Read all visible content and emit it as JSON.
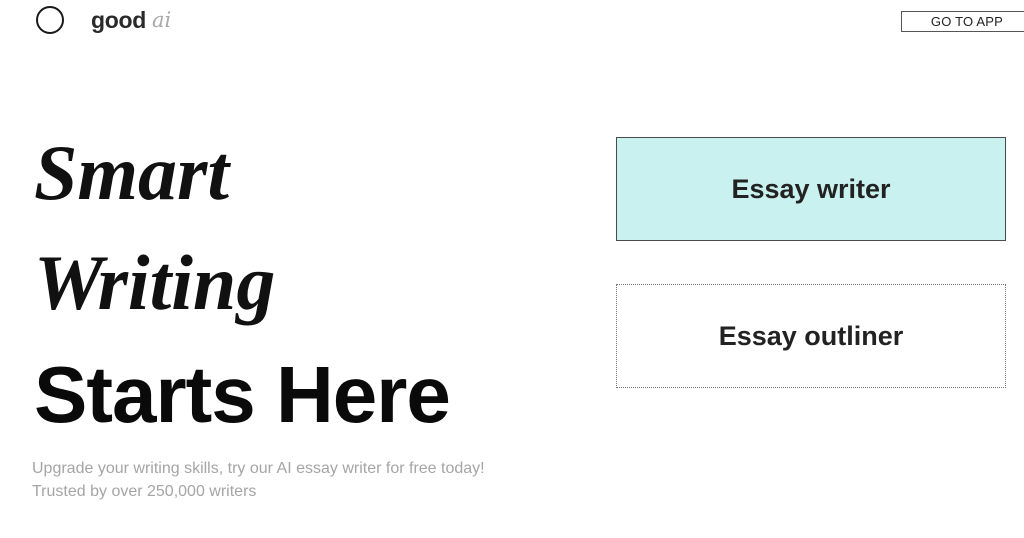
{
  "header": {
    "logo_text": "good",
    "logo_suffix": "ai",
    "cta_label": "GO TO APP"
  },
  "hero": {
    "line1": "Smart",
    "line2": "Writing",
    "line3": "Starts Here",
    "subtitle_1": "Upgrade your writing skills, try our AI essay writer for free today!",
    "subtitle_2": "Trusted by over 250,000 writers"
  },
  "tools": [
    {
      "label": "Essay writer",
      "background": "#c9f1ef"
    },
    {
      "label": "Essay outliner",
      "background": "#ffffff"
    }
  ],
  "icons": {
    "logo": "circle-logo-icon"
  }
}
